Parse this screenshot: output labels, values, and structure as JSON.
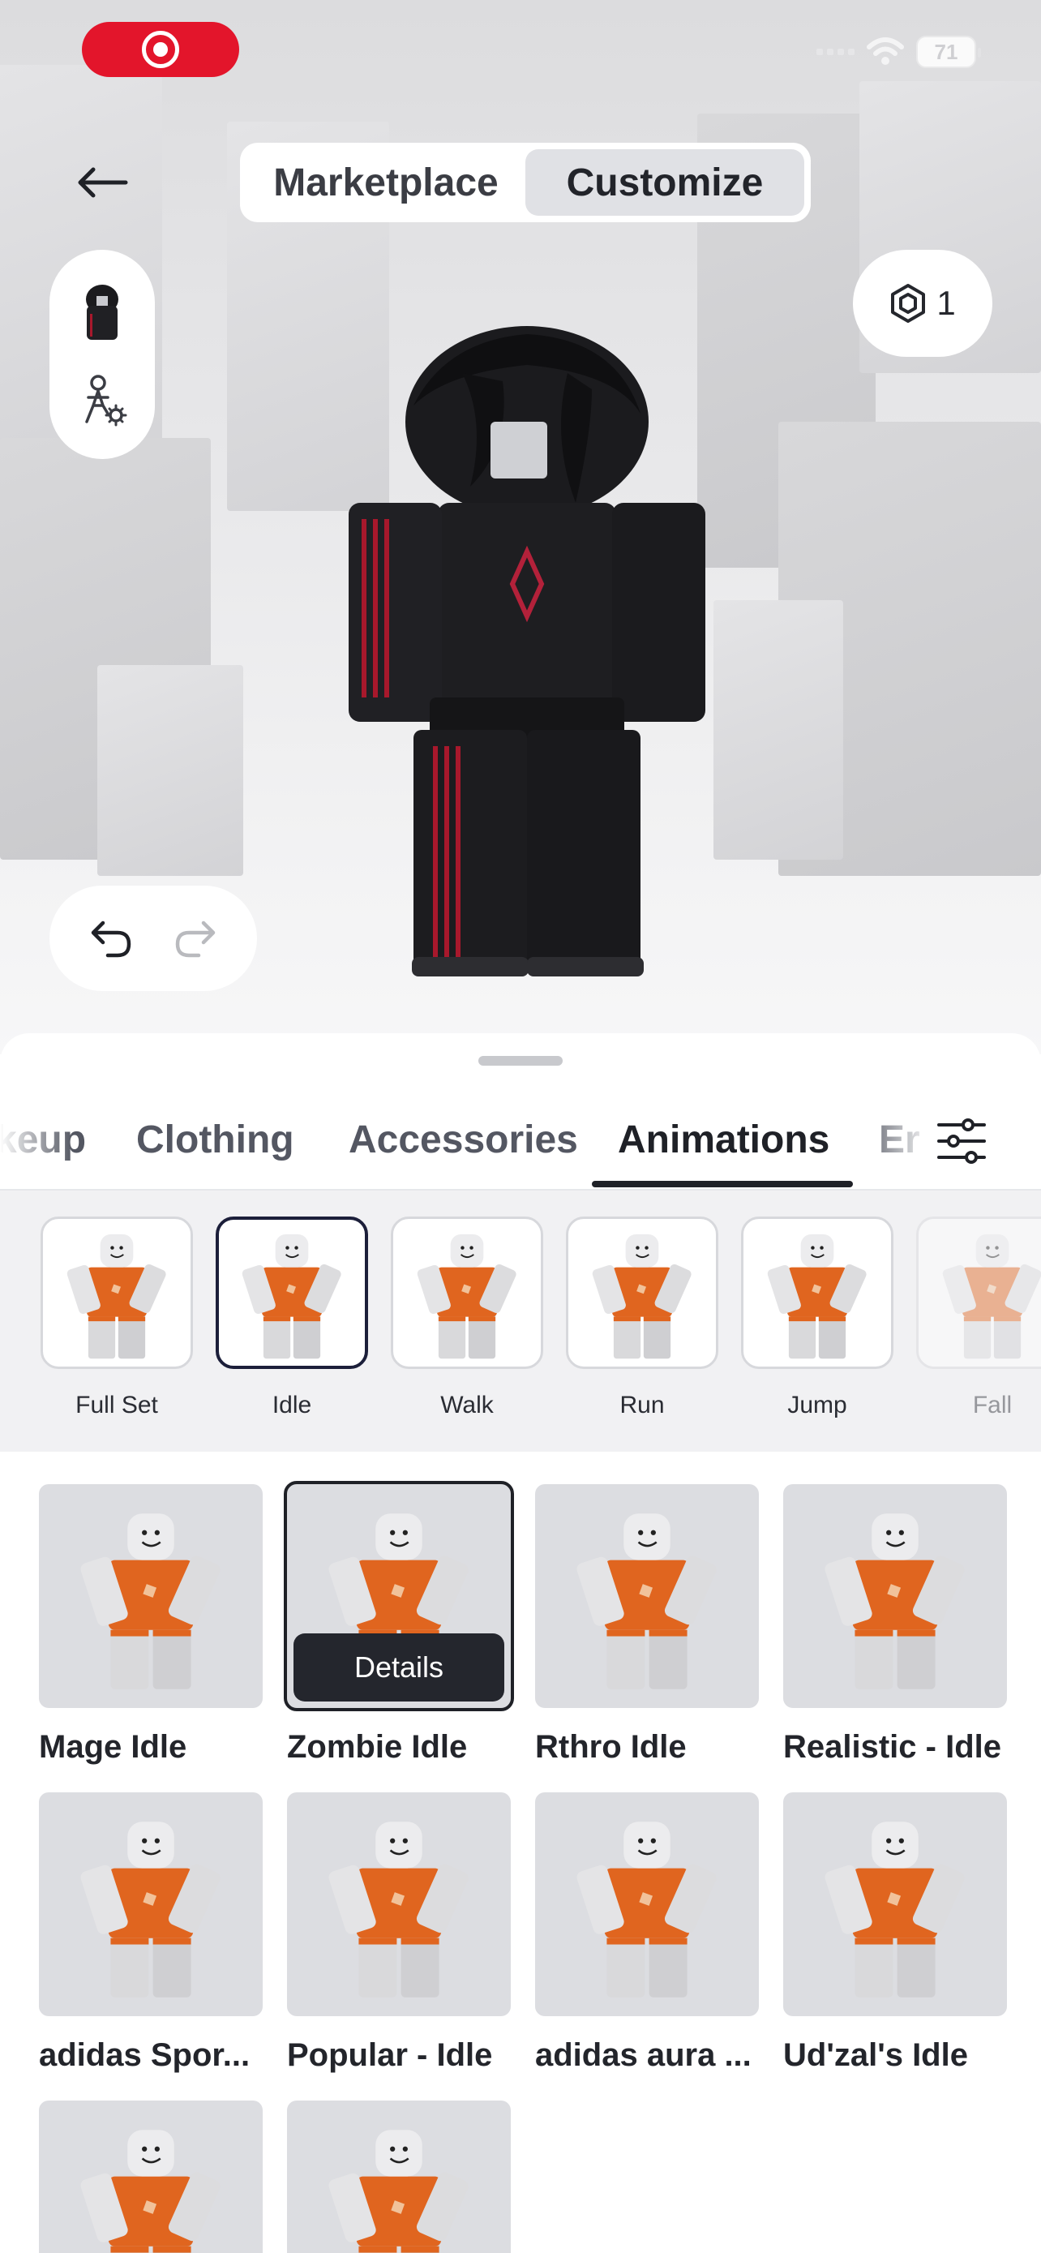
{
  "status_bar": {
    "battery": "71"
  },
  "header": {
    "segments": [
      "Marketplace",
      "Customize"
    ],
    "active_segment": "Customize"
  },
  "robux": {
    "count": "1"
  },
  "category_tabs": [
    {
      "label": "Makeup",
      "visible_text": "keup"
    },
    {
      "label": "Clothing",
      "visible_text": "Clothing"
    },
    {
      "label": "Accessories",
      "visible_text": "Accessories"
    },
    {
      "label": "Animations",
      "visible_text": "Animations",
      "active": true
    },
    {
      "label": "Emotes",
      "visible_text": "Er"
    }
  ],
  "subcategories": [
    {
      "label": "Full Set"
    },
    {
      "label": "Idle",
      "active": true
    },
    {
      "label": "Walk"
    },
    {
      "label": "Run"
    },
    {
      "label": "Jump"
    },
    {
      "label": "Fall"
    }
  ],
  "items": [
    {
      "name": "Mage Idle"
    },
    {
      "name": "Zombie Idle",
      "selected": true,
      "action": "Details"
    },
    {
      "name": "Rthro Idle"
    },
    {
      "name": "Realistic - Idle"
    },
    {
      "name": "adidas Spor..."
    },
    {
      "name": "Popular - Idle"
    },
    {
      "name": "adidas aura ..."
    },
    {
      "name": "Ud'zal's Idle"
    },
    {
      "name": ""
    },
    {
      "name": ""
    }
  ],
  "colors": {
    "record": "#e3152b",
    "active_tab": "#1f2127",
    "card_bg": "#dcdde1",
    "shirt": "#e0651f"
  }
}
